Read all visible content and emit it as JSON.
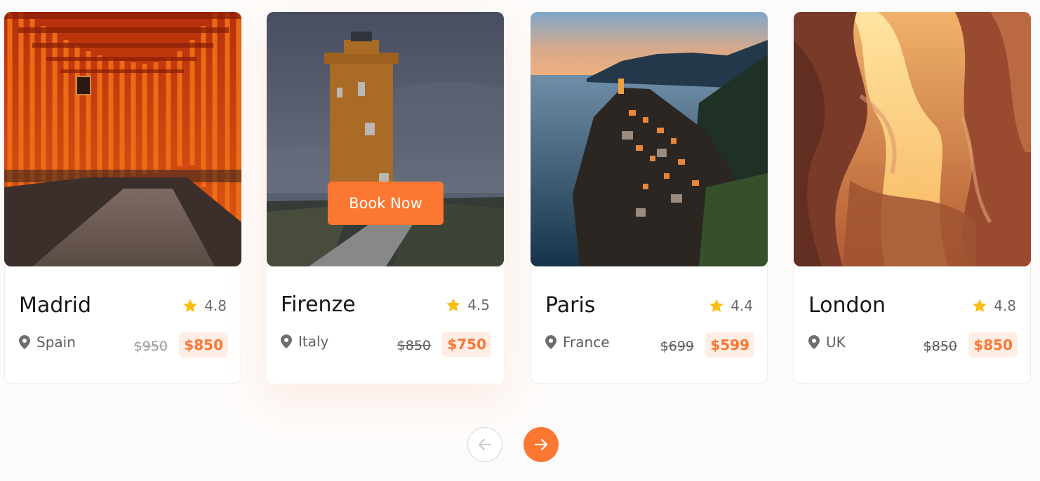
{
  "cards": [
    {
      "name": "Madrid",
      "rating": "4.8",
      "location": "Spain",
      "old_price": "$950",
      "new_price": "$850"
    },
    {
      "name": "Firenze",
      "rating": "4.5",
      "location": "Italy",
      "old_price": "$850",
      "new_price": "$750",
      "book_label": "Book Now"
    },
    {
      "name": "Paris",
      "rating": "4.4",
      "location": "France",
      "old_price": "$699",
      "new_price": "$599"
    },
    {
      "name": "London",
      "rating": "4.8",
      "location": "UK",
      "old_price": "$850",
      "new_price": "$850"
    }
  ],
  "icons": {
    "rating": "star-icon",
    "location": "map-pin-icon",
    "prev": "arrow-left-icon",
    "next": "arrow-right-icon"
  },
  "colors": {
    "accent": "#fb7732",
    "price_badge_bg": "#ffeee5",
    "star": "#fbbf12",
    "page_bg": "#fdfbfa"
  }
}
